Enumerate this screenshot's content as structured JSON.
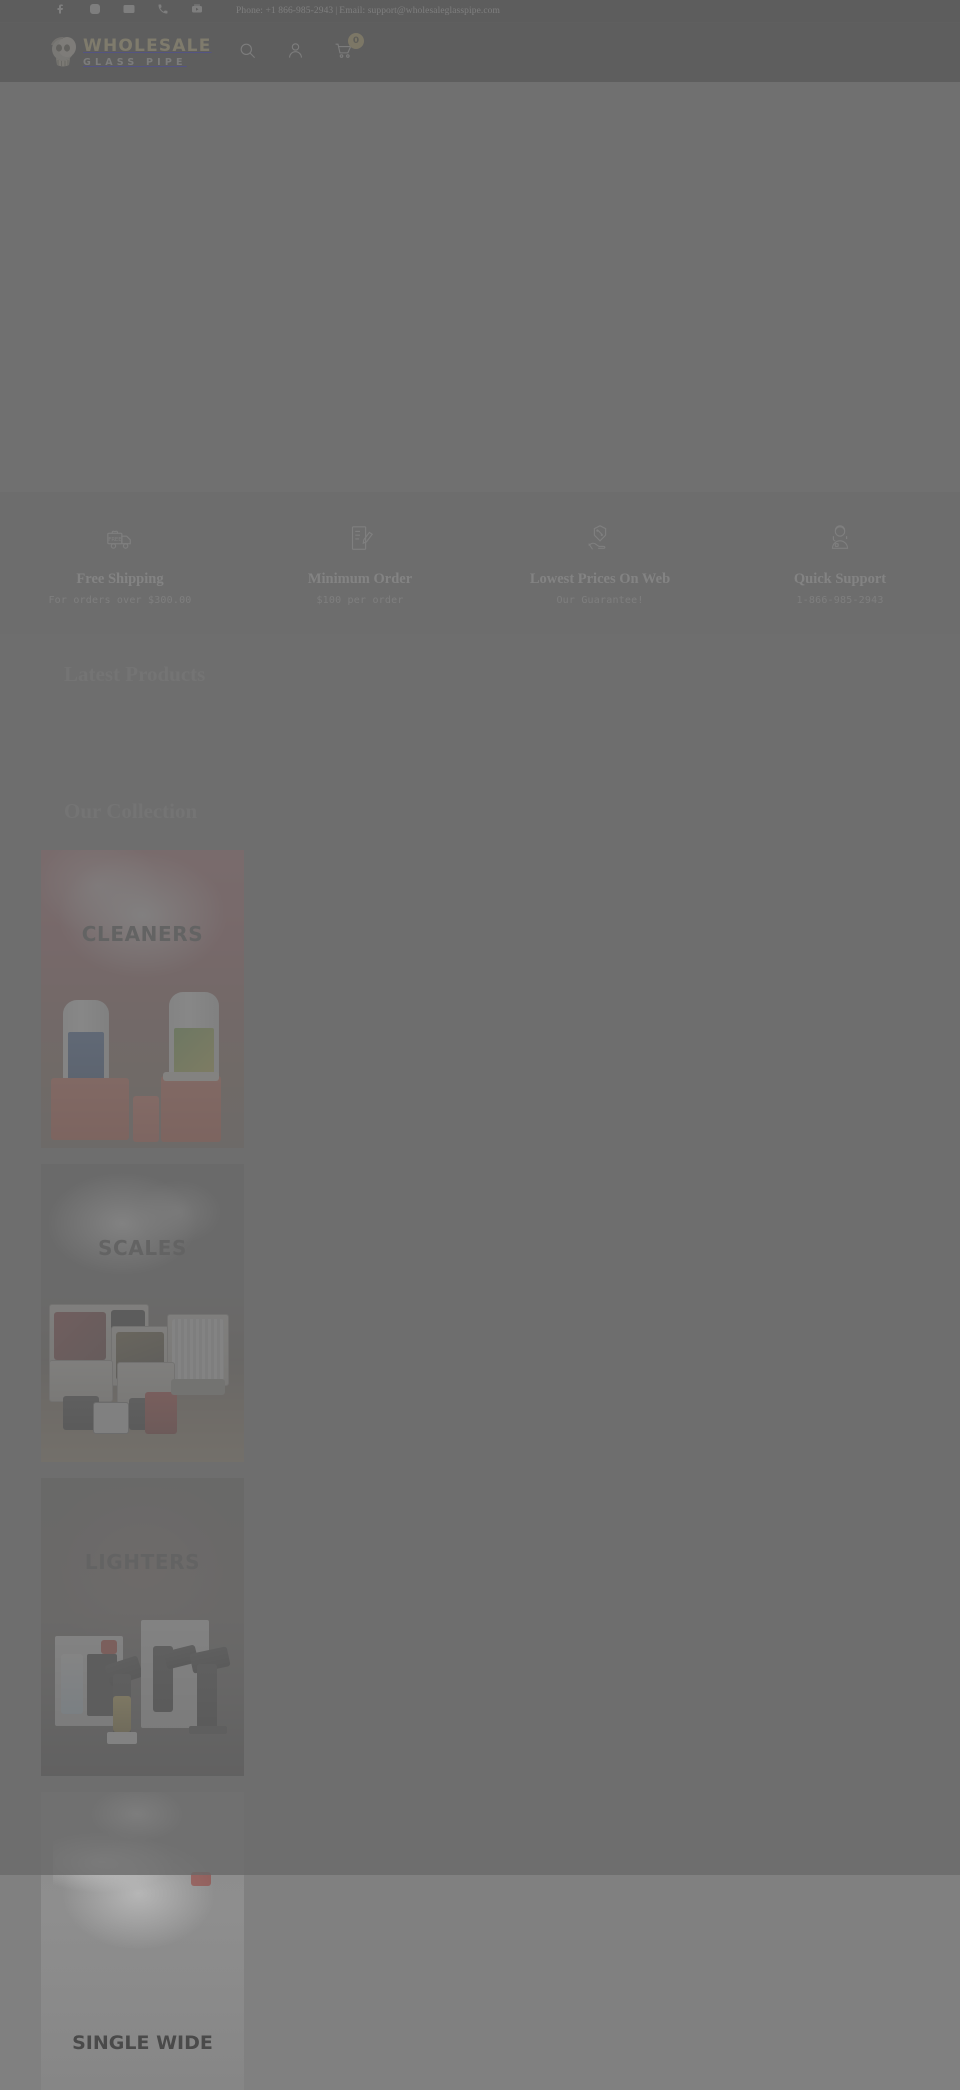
{
  "topbar": {
    "social": [
      {
        "name": "facebook-icon",
        "label": "Facebook"
      },
      {
        "name": "instagram-icon",
        "label": "Instagram"
      },
      {
        "name": "email-icon",
        "label": "Email"
      },
      {
        "name": "phone-icon",
        "label": "Phone"
      },
      {
        "name": "youtube-icon",
        "label": "YouTube"
      }
    ],
    "phone_label": "Phone: +1 866-985-2943",
    "separator": "|",
    "email_label": "Email: support@wholesaleglasspipe.com"
  },
  "header": {
    "logo_top": "WHOLESALE",
    "logo_bottom": "GLASS PIPE",
    "logo_mark": "skull-logo-icon",
    "actions": [
      {
        "name": "search-icon",
        "label": "Search"
      },
      {
        "name": "account-icon",
        "label": "My Account"
      },
      {
        "name": "cart-icon",
        "label": "Cart"
      }
    ],
    "cart_count": "0",
    "accent_color": "#d6c47a"
  },
  "features": [
    {
      "icon": "delivery-truck-icon",
      "title": "Free Shipping",
      "subtitle": "For orders over $300.00"
    },
    {
      "icon": "order-form-icon",
      "title": "Minimum Order",
      "subtitle": "$100 per order"
    },
    {
      "icon": "discount-hand-icon",
      "title": "Lowest Prices On Web",
      "subtitle": "Our Guarantee!"
    },
    {
      "icon": "support-agent-icon",
      "title": "Quick Support",
      "subtitle": "1-866-985-2943"
    }
  ],
  "sections": {
    "latest_products_title": "Latest Products",
    "collection_title": "Our Collection"
  },
  "collection": [
    {
      "label": "CLEANERS",
      "art": "art-cleaners"
    },
    {
      "label": "SCALES",
      "art": "art-scales"
    },
    {
      "label": "LIGHTERS",
      "art": "art-lighters"
    },
    {
      "label": "SINGLE WIDE",
      "art": "art-single"
    }
  ]
}
